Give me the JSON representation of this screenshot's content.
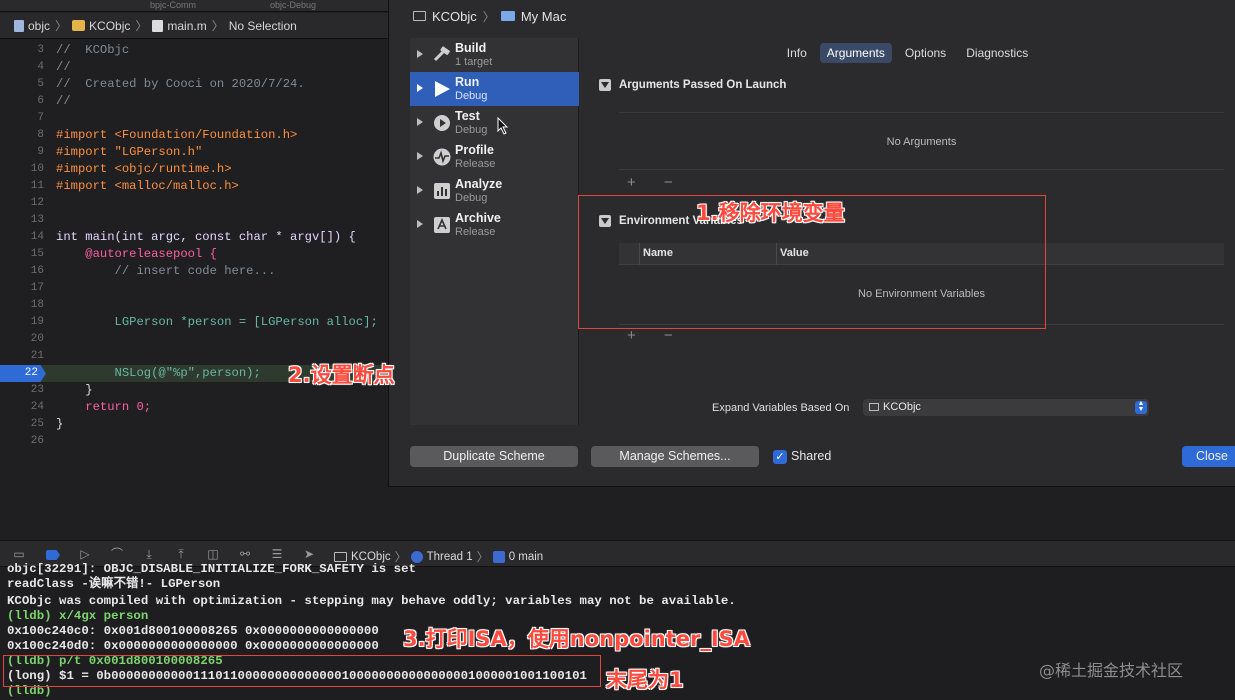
{
  "tabstrip": {
    "tab1": "bpjc-Comm",
    "tab2": "objc-Debug"
  },
  "jumpbar": {
    "project": "objc",
    "folder": "KCObjc",
    "file": "main.m",
    "selection": "No Selection"
  },
  "editor": {
    "lines": [
      {
        "n": "3",
        "text": "//  KCObjc"
      },
      {
        "n": "4",
        "text": "//"
      },
      {
        "n": "5",
        "text": "//  Created by Cooci on 2020/7/24."
      },
      {
        "n": "6",
        "text": "//"
      },
      {
        "n": "7",
        "text": ""
      },
      {
        "n": "8",
        "text": "#import <Foundation/Foundation.h>"
      },
      {
        "n": "9",
        "text": "#import \"LGPerson.h\""
      },
      {
        "n": "10",
        "text": "#import <objc/runtime.h>"
      },
      {
        "n": "11",
        "text": "#import <malloc/malloc.h>"
      },
      {
        "n": "12",
        "text": ""
      },
      {
        "n": "13",
        "text": ""
      },
      {
        "n": "14",
        "text": "int main(int argc, const char * argv[]) {"
      },
      {
        "n": "15",
        "text": "    @autoreleasepool {"
      },
      {
        "n": "16",
        "text": "        // insert code here..."
      },
      {
        "n": "17",
        "text": ""
      },
      {
        "n": "18",
        "text": ""
      },
      {
        "n": "19",
        "text": "        LGPerson *person = [LGPerson alloc];"
      },
      {
        "n": "20",
        "text": ""
      },
      {
        "n": "21",
        "text": ""
      },
      {
        "n": "22",
        "text": "        NSLog(@\"%p\",person);"
      },
      {
        "n": "23",
        "text": "    }"
      },
      {
        "n": "24",
        "text": "    return 0;"
      },
      {
        "n": "25",
        "text": "}"
      },
      {
        "n": "26",
        "text": ""
      }
    ]
  },
  "scheme": {
    "target": "KCObjc",
    "destination": "My Mac",
    "actions": [
      {
        "name": "Build",
        "sub": "1 target"
      },
      {
        "name": "Run",
        "sub": "Debug"
      },
      {
        "name": "Test",
        "sub": "Debug"
      },
      {
        "name": "Profile",
        "sub": "Release"
      },
      {
        "name": "Analyze",
        "sub": "Debug"
      },
      {
        "name": "Archive",
        "sub": "Release"
      }
    ],
    "tabs": [
      "Info",
      "Arguments",
      "Options",
      "Diagnostics"
    ],
    "args_title": "Arguments Passed On Launch",
    "args_empty": "No Arguments",
    "env_title": "Environment Variables",
    "env_col_name": "Name",
    "env_col_value": "Value",
    "env_empty": "No Environment Variables",
    "plus_minus": "+ −",
    "expand_label": "Expand Variables Based On",
    "expand_value": "KCObjc",
    "duplicate": "Duplicate Scheme",
    "manage": "Manage Schemes...",
    "shared": "Shared",
    "close": "Close"
  },
  "debugbar": {
    "target": "KCObjc",
    "thread": "Thread 1",
    "frame": "0 main"
  },
  "console": {
    "lines": [
      "objc[32291]: OBJC_DISABLE_INITIALIZE_FORK_SAFETY is set",
      "readClass -诶嘛不错!- LGPerson",
      "KCObjc was compiled with optimization - stepping may behave oddly; variables may not be available.",
      "(lldb) x/4gx person",
      "0x100c240c0: 0x001d800100008265 0x0000000000000000",
      "0x100c240d0: 0x0000000000000000 0x0000000000000000",
      "(lldb) p/t 0x001d800100008265",
      "(long) $1 = 0b0000000000011101100000000000000100000000000000001000001001100101",
      "(lldb)"
    ]
  },
  "annotations": {
    "a1": "1.移除环境变量",
    "a2": "2.设置断点",
    "a3": "3.打印ISA，使用nonpointer_ISA",
    "a4": "末尾为1"
  },
  "watermark": "@稀土掘金技术社区",
  "colors": {
    "accent": "#2f6bd6",
    "annotation": "#ff4a3d",
    "prompt": "#7cd46e"
  }
}
